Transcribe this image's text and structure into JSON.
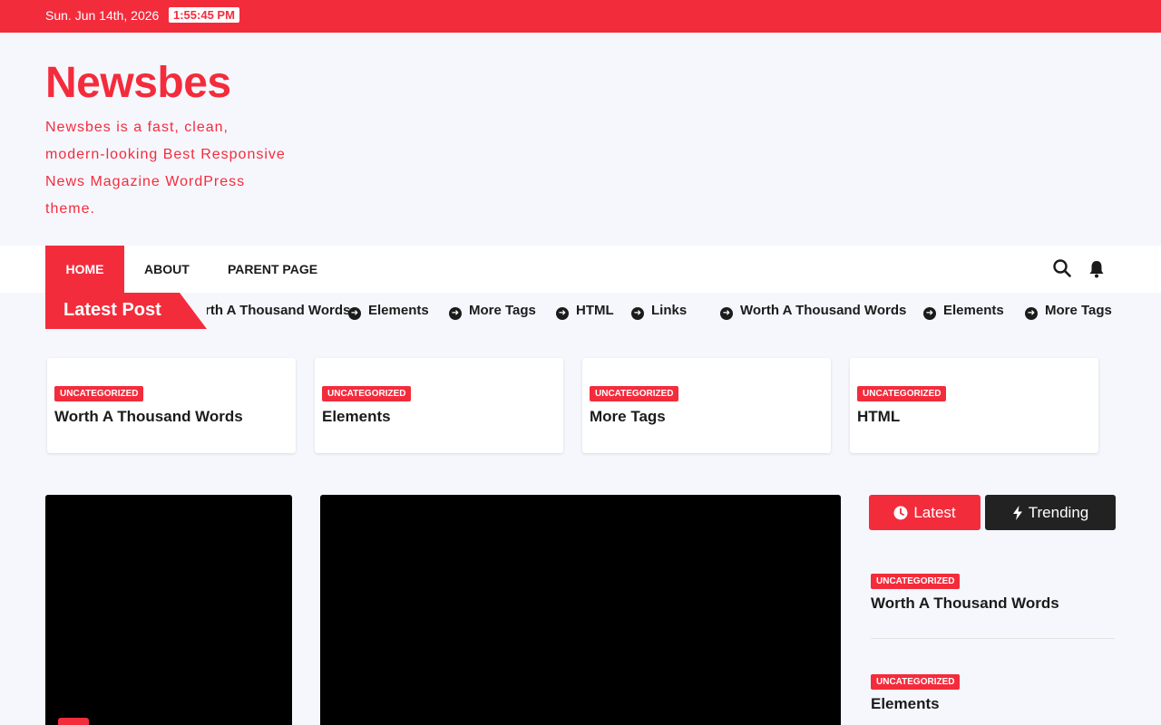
{
  "topbar": {
    "date": "Sun. Jun 14th, 2026",
    "time": "1:55:45 PM"
  },
  "branding": {
    "title": "Newsbes",
    "description": "Newsbes is a fast, clean, modern-looking Best Responsive News Magazine WordPress theme."
  },
  "nav": {
    "items": [
      "HOME",
      "ABOUT",
      "PARENT PAGE"
    ],
    "icons": [
      "search-icon",
      "bell-icon"
    ]
  },
  "ticker": {
    "label": "Latest Post",
    "items": [
      "Worth A Thousand Words",
      "Elements",
      "More Tags",
      "HTML",
      "Links",
      "Worth A Thousand Words",
      "Elements",
      "More Tags"
    ]
  },
  "cards": [
    {
      "category": "UNCATEGORIZED",
      "title": "Worth A Thousand Words"
    },
    {
      "category": "UNCATEGORIZED",
      "title": "Elements"
    },
    {
      "category": "UNCATEGORIZED",
      "title": "More Tags"
    },
    {
      "category": "UNCATEGORIZED",
      "title": "HTML"
    }
  ],
  "sidebar": {
    "tabs": {
      "latest": "Latest",
      "trending": "Trending"
    },
    "items": [
      {
        "category": "UNCATEGORIZED",
        "title": "Worth A Thousand Words"
      },
      {
        "category": "UNCATEGORIZED",
        "title": "Elements"
      }
    ]
  },
  "colors": {
    "accent": "#f32c3c",
    "dark": "#222222",
    "background": "#f6f7fd"
  }
}
